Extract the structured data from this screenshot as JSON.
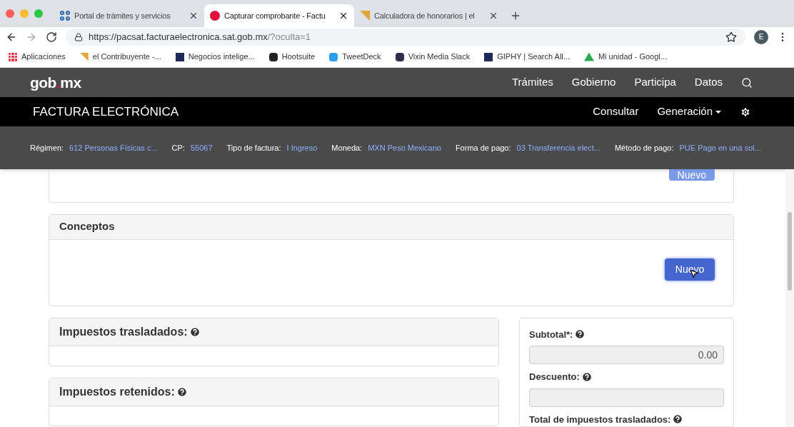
{
  "browser": {
    "tabs": [
      {
        "title": "Portal de trámites y servicios",
        "selected": false
      },
      {
        "title": "Capturar comprobante - Factu",
        "selected": true
      },
      {
        "title": "Calculadora de honorarios | el",
        "selected": false
      }
    ],
    "url_host": "https://pacsat.facturaelectronica.sat.gob.mx",
    "url_path": "/?oculta=1",
    "profile": "E",
    "bookmarks": [
      "Aplicaciones",
      "el Contribuyente -...",
      "Negocios intelige...",
      "Hootsuite",
      "TweetDeck",
      "Vixin Media Slack",
      "GIPHY | Search All...",
      "Mi unidad - Googl..."
    ]
  },
  "site": {
    "logo_a": "gob",
    "logo_dot": ".",
    "logo_b": "mx",
    "nav": [
      "Trámites",
      "Gobierno",
      "Participa",
      "Datos"
    ]
  },
  "app": {
    "title": "FACTURA ELECTRÓNICA",
    "menu": [
      {
        "label": "Consultar",
        "dropdown": false
      },
      {
        "label": "Generación",
        "dropdown": true
      }
    ]
  },
  "info": [
    {
      "label": "Régimen:",
      "value": "612 Personas Físicas c..."
    },
    {
      "label": "CP:",
      "value": "55067"
    },
    {
      "label": "Tipo de factura:",
      "value": "I Ingreso"
    },
    {
      "label": "Moneda:",
      "value": "MXN Peso Mexicano"
    },
    {
      "label": "Forma de pago:",
      "value": "03 Transferencia elect..."
    },
    {
      "label": "Método de pago:",
      "value": "PUE Pago en una sol..."
    }
  ],
  "top_panel": {
    "button": "Nuevo"
  },
  "conceptos": {
    "title": "Conceptos",
    "button": "Nuevo"
  },
  "impuestos": [
    {
      "title": "Impuestos trasladados:"
    },
    {
      "title": "Impuestos retenidos:"
    }
  ],
  "totals": [
    {
      "label": "Subtotal*:",
      "value": "0.00"
    },
    {
      "label": "Descuento:"
    },
    {
      "label": "Total de impuestos trasladados:"
    }
  ]
}
